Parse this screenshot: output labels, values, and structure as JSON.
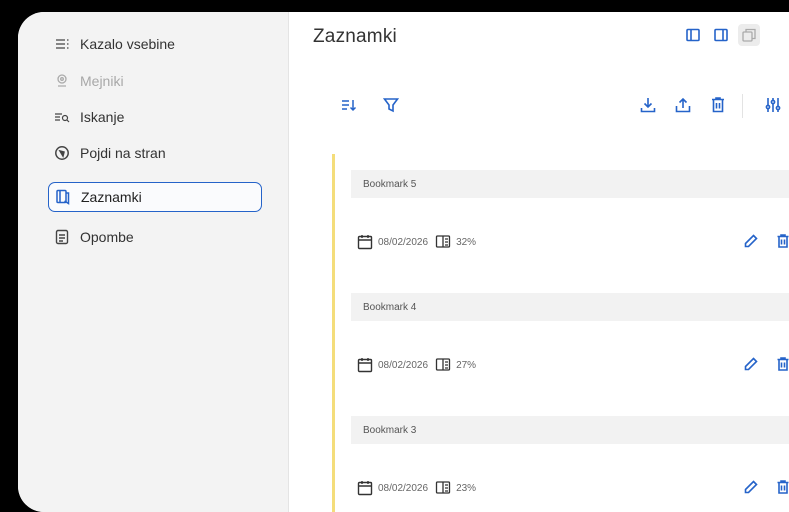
{
  "sidebar": {
    "items": [
      {
        "label": "Kazalo vsebine",
        "icon": "list-icon",
        "state": "normal"
      },
      {
        "label": "Mejniki",
        "icon": "landmark-icon",
        "state": "disabled"
      },
      {
        "label": "Iskanje",
        "icon": "search-list-icon",
        "state": "normal"
      },
      {
        "label": "Pojdi na stran",
        "icon": "compass-icon",
        "state": "normal"
      },
      {
        "label": "Zaznamki",
        "icon": "bookmark-icon",
        "state": "active"
      },
      {
        "label": "Opombe",
        "icon": "notes-icon",
        "state": "normal"
      }
    ]
  },
  "main": {
    "title": "Zaznamki",
    "bookmarks": [
      {
        "title": "Bookmark 5",
        "date": "08/02/2026",
        "progress": "32%"
      },
      {
        "title": "Bookmark 4",
        "date": "08/02/2026",
        "progress": "27%"
      },
      {
        "title": "Bookmark 3",
        "date": "08/02/2026",
        "progress": "23%"
      }
    ]
  },
  "colors": {
    "accent": "#2563c9",
    "card_border": "#f4dd7a",
    "sidebar_bg": "#f3f3f3"
  }
}
